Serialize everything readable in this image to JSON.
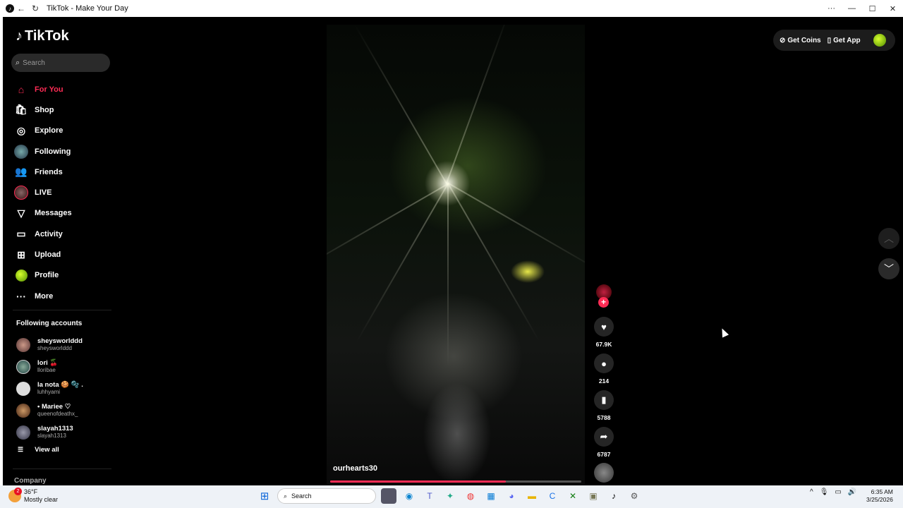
{
  "window": {
    "title": "TikTok - Make Your Day",
    "menu": "···",
    "minimize": "—",
    "maximize": "☐",
    "close": "✕"
  },
  "sidebar": {
    "logo": "TikTok",
    "search_placeholder": "Search",
    "nav": [
      {
        "label": "For You",
        "icon": "home-icon"
      },
      {
        "label": "Shop",
        "icon": "shop-icon"
      },
      {
        "label": "Explore",
        "icon": "compass-icon"
      },
      {
        "label": "Following",
        "icon": "following-avatar-icon"
      },
      {
        "label": "Friends",
        "icon": "friends-icon"
      },
      {
        "label": "LIVE",
        "icon": "live-avatar-icon"
      },
      {
        "label": "Messages",
        "icon": "paper-plane-icon"
      },
      {
        "label": "Activity",
        "icon": "activity-icon"
      },
      {
        "label": "Upload",
        "icon": "upload-icon"
      },
      {
        "label": "Profile",
        "icon": "profile-avatar-icon"
      },
      {
        "label": "More",
        "icon": "more-icon"
      }
    ],
    "following_title": "Following accounts",
    "following": [
      {
        "name": "sheysworlddd",
        "handle": "sheysworlddd"
      },
      {
        "name": "lori 🍒",
        "handle": "lloribae"
      },
      {
        "name": "la nota 🍪 🫧 .",
        "handle": "luhhyami"
      },
      {
        "name": "• Mariee ♡",
        "handle": "queenofdeathx_"
      },
      {
        "name": "slayah1313",
        "handle": "slayah1313"
      }
    ],
    "view_all": "View all",
    "company": "Company"
  },
  "topbar": {
    "get_coins": "Get Coins",
    "get_app": "Get App"
  },
  "video": {
    "username": "ourhearts30",
    "progress": 0.7,
    "likes": "67.9K",
    "comments": "214",
    "saves": "5788",
    "shares": "6787"
  },
  "taskbar": {
    "temperature": "36°F",
    "weather": "Mostly clear",
    "weather_badge": "2",
    "search": "Search",
    "time": "6:35 AM",
    "date": "3/25/2026"
  }
}
